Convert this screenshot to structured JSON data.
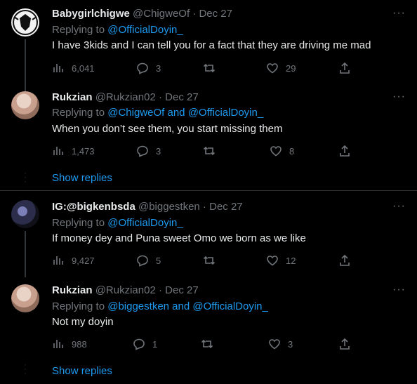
{
  "tweets": [
    {
      "name": "Babygirlchigwe",
      "handle": "@ChigweOf",
      "date": "Dec 27",
      "replying_prefix": "Replying to ",
      "mention1": "@OfficialDoyin_",
      "and": "",
      "mention2": "",
      "text": "I have 3kids and I can tell you for a fact that they are driving me mad",
      "views": "6,041",
      "replies": "3",
      "retweets": "",
      "likes": "29"
    },
    {
      "name": "Rukzian",
      "handle": "@Rukzian02",
      "date": "Dec 27",
      "replying_prefix": "Replying to ",
      "mention1": "@ChigweOf",
      "and": " and ",
      "mention2": "@OfficialDoyin_",
      "text": "When you don’t see them, you start missing them",
      "views": "1,473",
      "replies": "3",
      "retweets": "",
      "likes": "8"
    },
    {
      "name": "IG:@bigkenbsda",
      "handle": "@biggestken",
      "date": "Dec 27",
      "replying_prefix": "Replying to ",
      "mention1": "@OfficialDoyin_",
      "and": "",
      "mention2": "",
      "text": "If money dey and Puna sweet Omo we born as we like",
      "views": "9,427",
      "replies": "5",
      "retweets": "",
      "likes": "12"
    },
    {
      "name": "Rukzian",
      "handle": "@Rukzian02",
      "date": "Dec 27",
      "replying_prefix": "Replying to ",
      "mention1": "@biggestken",
      "and": " and ",
      "mention2": "@OfficialDoyin_",
      "text": "Not my doyin",
      "views": "988",
      "replies": "1",
      "retweets": "",
      "likes": "3"
    }
  ],
  "show_replies_label": "Show replies",
  "separator": " · ",
  "more_label": "···",
  "colors": {
    "background": "#000000",
    "accent": "#1d9bf0",
    "muted": "#71767b",
    "text": "#e7e9ea"
  },
  "icons": [
    "views-icon",
    "reply-icon",
    "retweet-icon",
    "like-icon",
    "share-icon",
    "more-icon"
  ]
}
